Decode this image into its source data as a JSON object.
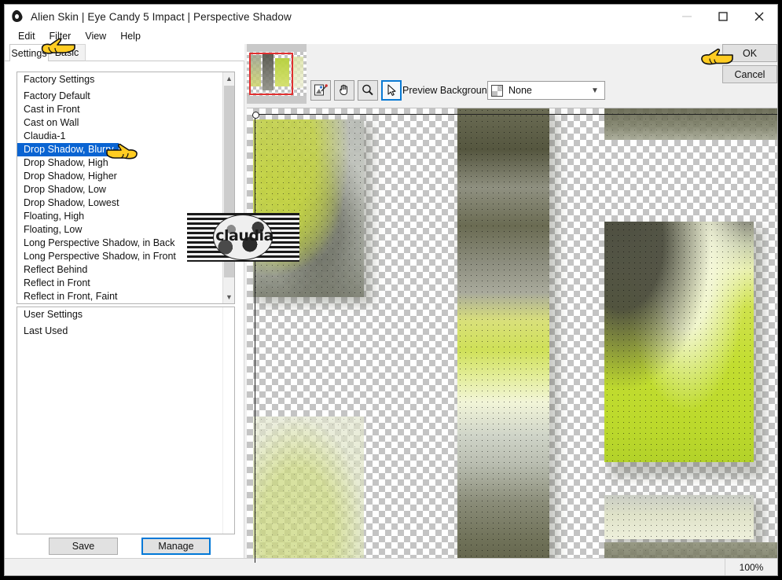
{
  "window": {
    "title": "Alien Skin | Eye Candy 5 Impact | Perspective Shadow",
    "app_icon": "teardrop-icon",
    "minimize_label": "minimize-icon",
    "maximize_label": "maximize-icon",
    "close_label": "close-icon"
  },
  "menubar": {
    "items": [
      {
        "label": "Edit"
      },
      {
        "label": "Filter"
      },
      {
        "label": "View"
      },
      {
        "label": "Help"
      }
    ]
  },
  "tabs": [
    {
      "label": "Settings",
      "active": true
    },
    {
      "label": "Basic",
      "active": false
    }
  ],
  "settings_list": {
    "groups": [
      {
        "header": "Factory Settings",
        "items": [
          "Factory Default",
          "Cast in Front",
          "Cast on Wall",
          "Claudia-1",
          "Drop Shadow, Blurry",
          "Drop Shadow, High",
          "Drop Shadow, Higher",
          "Drop Shadow, Low",
          "Drop Shadow, Lowest",
          "Floating, High",
          "Floating, Low",
          "Long Perspective Shadow, in Back",
          "Long Perspective Shadow, in Front",
          "Reflect Behind",
          "Reflect in Front",
          "Reflect in Front, Faint"
        ]
      }
    ],
    "selected": "Drop Shadow, Blurry",
    "selection_color": "#0a64d2"
  },
  "user_list": {
    "groups": [
      {
        "header": "User Settings",
        "items": [
          "Last Used"
        ]
      }
    ]
  },
  "buttons": {
    "save": "Save",
    "manage": "Manage",
    "ok": "OK",
    "cancel": "Cancel",
    "focus_color": "#0078d7"
  },
  "preview_toolbar": {
    "tools": [
      {
        "name": "sample-image-icon",
        "active": false
      },
      {
        "name": "hand-pan-icon",
        "active": false
      },
      {
        "name": "zoom-magnifier-icon",
        "active": false
      },
      {
        "name": "arrow-pointer-icon",
        "active": true
      }
    ],
    "background_label": "Preview Background:",
    "background_value": "None",
    "background_options": [
      "None"
    ]
  },
  "statusbar": {
    "zoom": "100%"
  },
  "watermark": {
    "text": "claudia"
  },
  "cursors": [
    {
      "name": "pointing-hand-cursor-filter"
    },
    {
      "name": "pointing-hand-cursor-list"
    },
    {
      "name": "pointing-hand-cursor-ok"
    }
  ]
}
